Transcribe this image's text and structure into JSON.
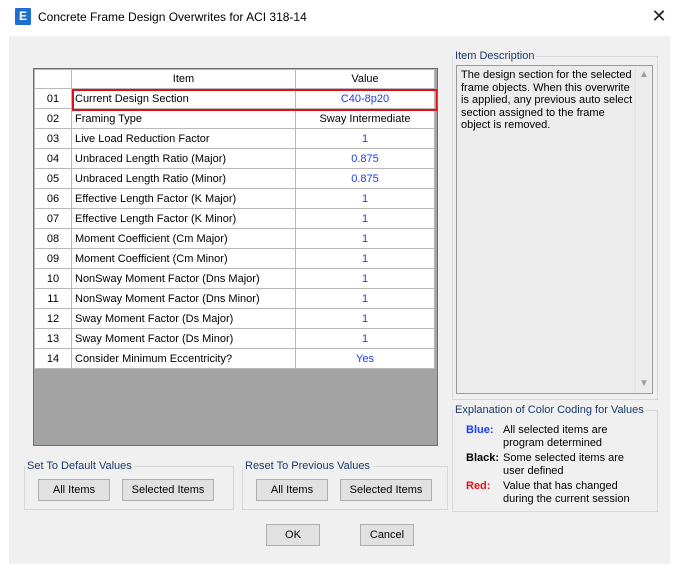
{
  "window": {
    "icon_letter": "E",
    "title": "Concrete Frame Design Overwrites for ACI 318-14",
    "close_glyph": "✕"
  },
  "grid": {
    "headers": {
      "num": "",
      "item": "Item",
      "value": "Value"
    },
    "rows": [
      {
        "num": "01",
        "item": "Current Design Section",
        "value": "C40-8p20",
        "value_color": "blue"
      },
      {
        "num": "02",
        "item": "Framing Type",
        "value": "Sway Intermediate",
        "value_color": "black"
      },
      {
        "num": "03",
        "item": "Live Load Reduction Factor",
        "value": "1",
        "value_color": "blue"
      },
      {
        "num": "04",
        "item": "Unbraced Length Ratio (Major)",
        "value": "0.875",
        "value_color": "blue"
      },
      {
        "num": "05",
        "item": "Unbraced Length Ratio (Minor)",
        "value": "0.875",
        "value_color": "blue"
      },
      {
        "num": "06",
        "item": "Effective Length Factor (K Major)",
        "value": "1",
        "value_color": "blue"
      },
      {
        "num": "07",
        "item": "Effective Length Factor (K Minor)",
        "value": "1",
        "value_color": "blue"
      },
      {
        "num": "08",
        "item": "Moment Coefficient (Cm Major)",
        "value": "1",
        "value_color": "blue"
      },
      {
        "num": "09",
        "item": "Moment Coefficient (Cm Minor)",
        "value": "1",
        "value_color": "blue"
      },
      {
        "num": "10",
        "item": "NonSway Moment Factor (Dns Major)",
        "value": "1",
        "value_color": "blue"
      },
      {
        "num": "11",
        "item": "NonSway Moment Factor (Dns Minor)",
        "value": "1",
        "value_color": "blue"
      },
      {
        "num": "12",
        "item": "Sway Moment Factor (Ds Major)",
        "value": "1",
        "value_color": "blue"
      },
      {
        "num": "13",
        "item": "Sway Moment Factor (Ds Minor)",
        "value": "1",
        "value_color": "blue"
      },
      {
        "num": "14",
        "item": "Consider Minimum Eccentricity?",
        "value": "Yes",
        "value_color": "blue"
      }
    ],
    "highlighted_row": "01"
  },
  "item_description": {
    "label": "Item Description",
    "text": "The design section for the selected frame objects.  When this overwrite is applied, any previous auto select section assigned to the frame object is removed."
  },
  "color_coding": {
    "label": "Explanation of Color Coding for Values",
    "entries": [
      {
        "key": "Blue:",
        "color": "#1a3cf0",
        "desc": "All selected items are program determined"
      },
      {
        "key": "Black:",
        "color": "#000000",
        "desc": "Some selected items are user defined"
      },
      {
        "key": "Red:",
        "color": "#e0101a",
        "desc": "Value that has changed during the current session"
      }
    ]
  },
  "set_default": {
    "label": "Set To Default Values",
    "all_items": "All Items",
    "selected_items": "Selected Items"
  },
  "reset_previous": {
    "label": "Reset To Previous Values",
    "all_items": "All Items",
    "selected_items": "Selected Items"
  },
  "buttons": {
    "ok": "OK",
    "cancel": "Cancel"
  },
  "colors": {
    "blue_value": "#1a3cf0",
    "highlight": "#e0101a",
    "app_icon": "#1f6fd0"
  }
}
